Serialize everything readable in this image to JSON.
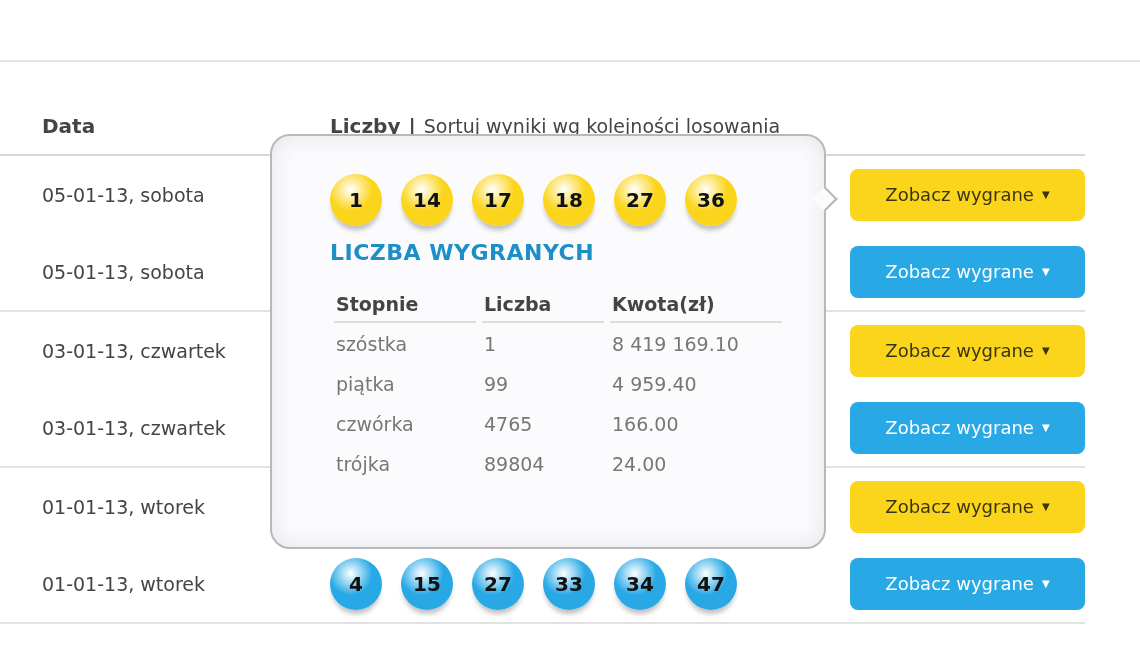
{
  "header": {
    "date_label": "Data",
    "numbers_label": "Liczby",
    "separator": "|",
    "sort_link": "Sortuj wyniki wg kolejności losowania"
  },
  "rows": [
    {
      "date": "05-01-13, sobota",
      "color": "#fbd51c",
      "balls": [],
      "button": "Zobacz wygrane",
      "caret": "▼"
    },
    {
      "date": "05-01-13, sobota",
      "color": "#28a9e6",
      "balls": [],
      "button": "Zobacz wygrane",
      "caret": "▼"
    },
    {
      "date": "03-01-13, czwartek",
      "color": "#fbd51c",
      "balls": [],
      "button": "Zobacz wygrane",
      "caret": "▼"
    },
    {
      "date": "03-01-13, czwartek",
      "color": "#28a9e6",
      "balls": [],
      "button": "Zobacz wygrane",
      "caret": "▼"
    },
    {
      "date": "01-01-13, wtorek",
      "color": "#fbd51c",
      "balls": [],
      "button": "Zobacz wygrane",
      "caret": "▼"
    },
    {
      "date": "01-01-13, wtorek",
      "color": "#28a9e6",
      "balls": [
        "4",
        "15",
        "27",
        "33",
        "34",
        "47"
      ],
      "button": "Zobacz wygrane",
      "caret": "▼"
    }
  ],
  "popup": {
    "color": "#fbd51c",
    "balls": [
      "1",
      "14",
      "17",
      "18",
      "27",
      "36"
    ],
    "title": "LICZBA WYGRANYCH",
    "columns": [
      "Stopnie",
      "Liczba",
      "Kwota(zł)"
    ],
    "rows": [
      [
        "szóstka",
        "1",
        "8 419 169.10"
      ],
      [
        "piątka",
        "99",
        "4 959.40"
      ],
      [
        "czwórka",
        "4765",
        "166.00"
      ],
      [
        "trójka",
        "89804",
        "24.00"
      ]
    ]
  }
}
